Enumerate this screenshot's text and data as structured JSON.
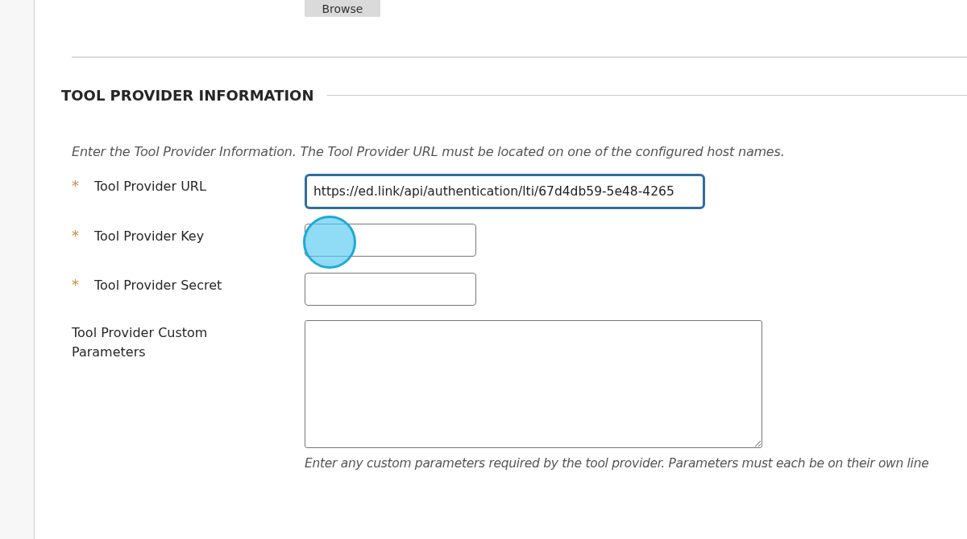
{
  "browse_button": {
    "label": "Browse"
  },
  "section": {
    "title": "TOOL PROVIDER INFORMATION",
    "instructions": "Enter the Tool Provider Information. The Tool Provider URL must be located on one of the configured host names."
  },
  "fields": [
    {
      "kind": "wide_text",
      "marker": "*",
      "label": "Tool Provider URL",
      "focused": true,
      "value": "https://ed.link/api/authentication/lti/67d4db59-5e48-4265"
    },
    {
      "kind": "text",
      "marker": "*",
      "label": "Tool Provider Key",
      "focused": false,
      "click_marker": true
    },
    {
      "kind": "text",
      "marker": "*",
      "label": "Tool Provider Secret",
      "focused": false
    },
    {
      "kind": "textarea",
      "label": "Tool Provider Custom Parameters",
      "hint": "Enter any custom parameters required by the tool provider. Parameters must each be on their own line"
    }
  ]
}
